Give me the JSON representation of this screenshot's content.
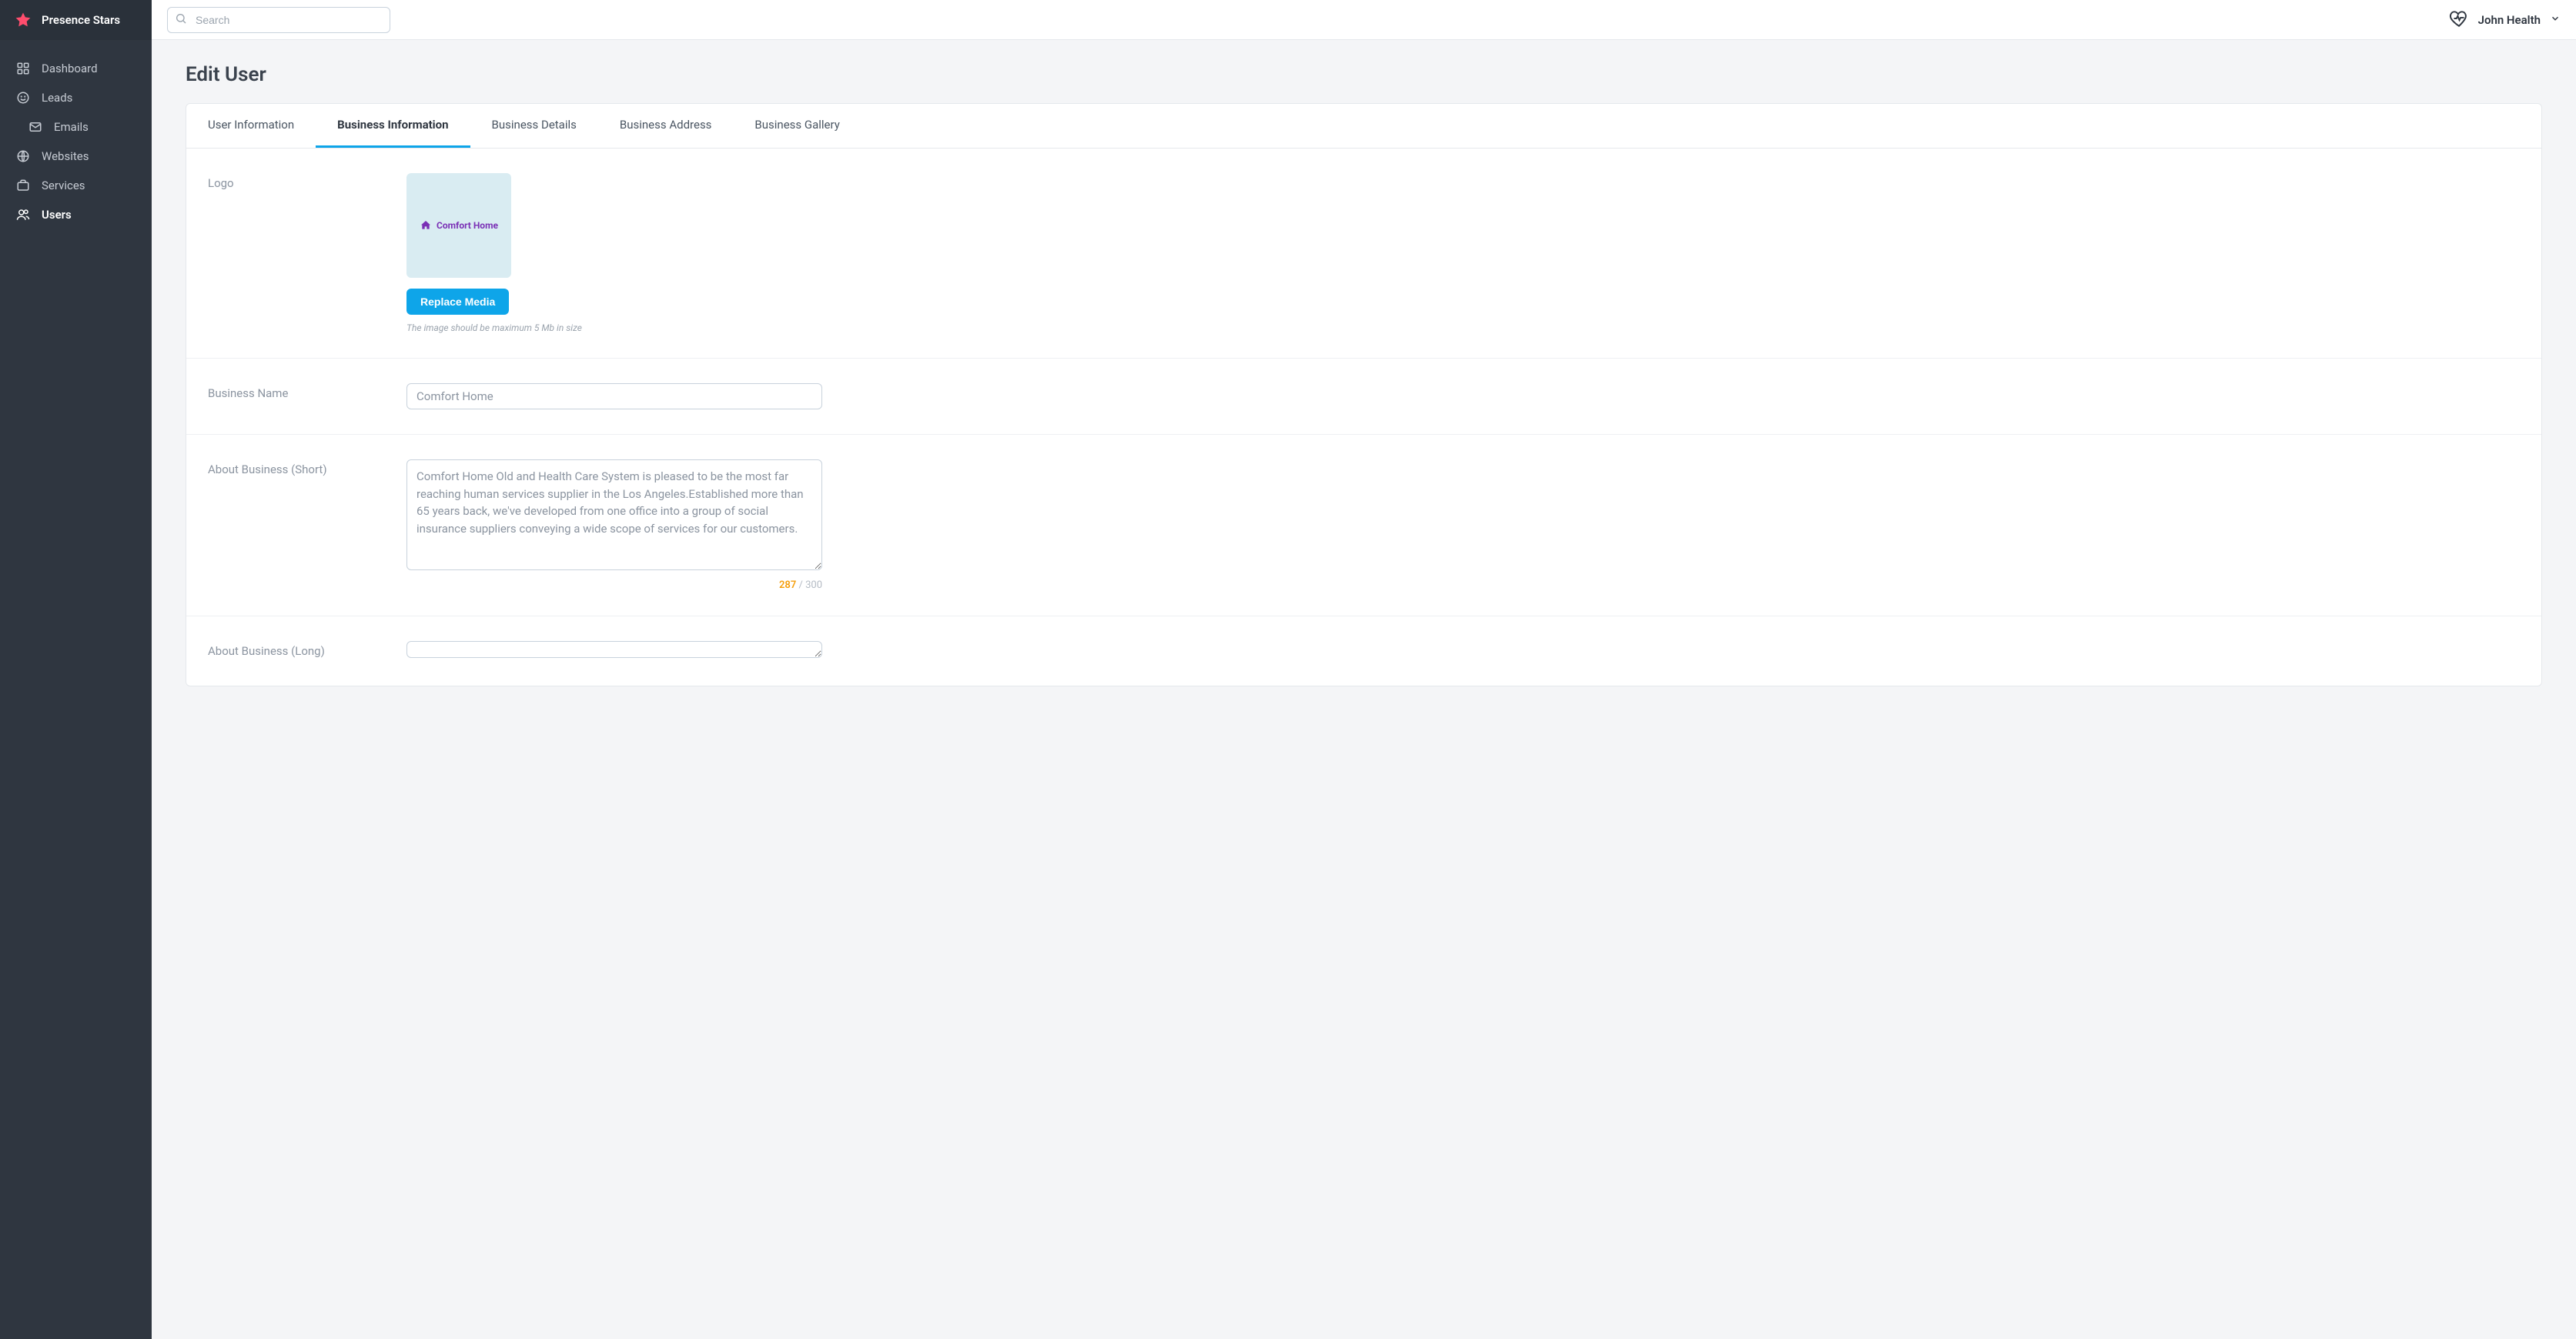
{
  "brand": {
    "name": "Presence Stars"
  },
  "sidebar": {
    "items": [
      {
        "label": "Dashboard",
        "icon": "dashboard"
      },
      {
        "label": "Leads",
        "icon": "smiley"
      },
      {
        "label": "Emails",
        "icon": "mail",
        "indented": true
      },
      {
        "label": "Websites",
        "icon": "globe"
      },
      {
        "label": "Services",
        "icon": "briefcase"
      },
      {
        "label": "Users",
        "icon": "users",
        "active": true
      }
    ]
  },
  "header": {
    "search_placeholder": "Search",
    "profile_name": "John Health"
  },
  "page": {
    "title": "Edit User",
    "tabs": [
      {
        "label": "User Information"
      },
      {
        "label": "Business Information",
        "active": true
      },
      {
        "label": "Business Details"
      },
      {
        "label": "Business Address"
      },
      {
        "label": "Business Gallery"
      }
    ],
    "fields": {
      "logo": {
        "label": "Logo",
        "logo_text": "Comfort Home",
        "replace_button": "Replace Media",
        "hint": "The image should be maximum 5 Mb in size"
      },
      "business_name": {
        "label": "Business Name",
        "value": "Comfort Home"
      },
      "about_short": {
        "label": "About Business (Short)",
        "value": "Comfort Home Old and Health Care System is pleased to be the most far reaching human services supplier in the Los Angeles.Established more than 65 years back, we've developed from one office into a group of social insurance suppliers conveying a wide scope of services for our customers.",
        "counter_current": "287",
        "counter_sep": " / ",
        "counter_max": "300"
      },
      "about_long": {
        "label": "About Business (Long)"
      }
    }
  }
}
